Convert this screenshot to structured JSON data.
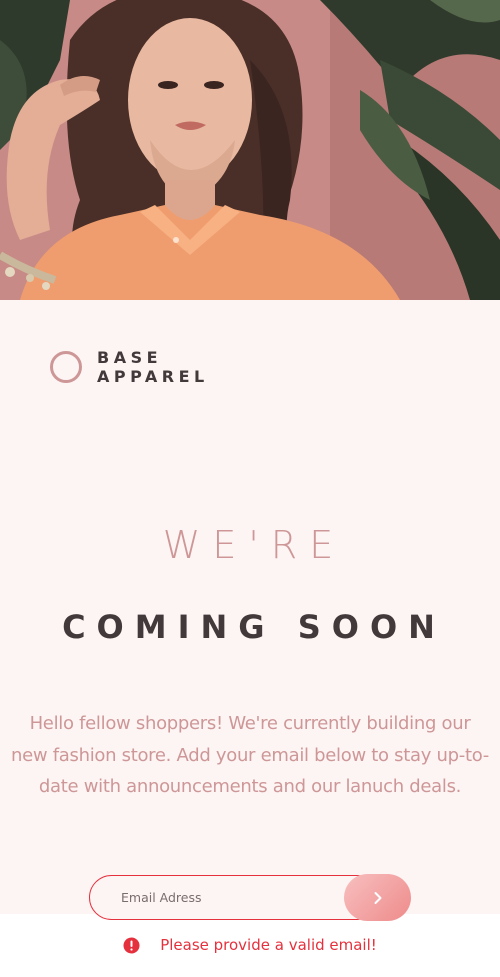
{
  "hero": {
    "image": "woman-in-orange-shirt-photo"
  },
  "logo": {
    "icon": "circle-logo-icon",
    "line1": "BASE",
    "line2": "APPAREL"
  },
  "headline": {
    "line1": "WE'RE",
    "line2": "COMING SOON"
  },
  "description": "Hello fellow shoppers! We're currently building our new fashion store. Add your email below to stay up-to-date with announcements and our lanuch deals.",
  "form": {
    "email_placeholder": "Email Adress",
    "email_value": "",
    "submit_icon": "chevron-right-icon"
  },
  "error": {
    "icon": "error-icon",
    "message": "Please provide a valid email!"
  },
  "colors": {
    "accent": "#ce9797",
    "dark": "#423a3a",
    "error": "#e5313d",
    "background": "#fdf4f4"
  }
}
